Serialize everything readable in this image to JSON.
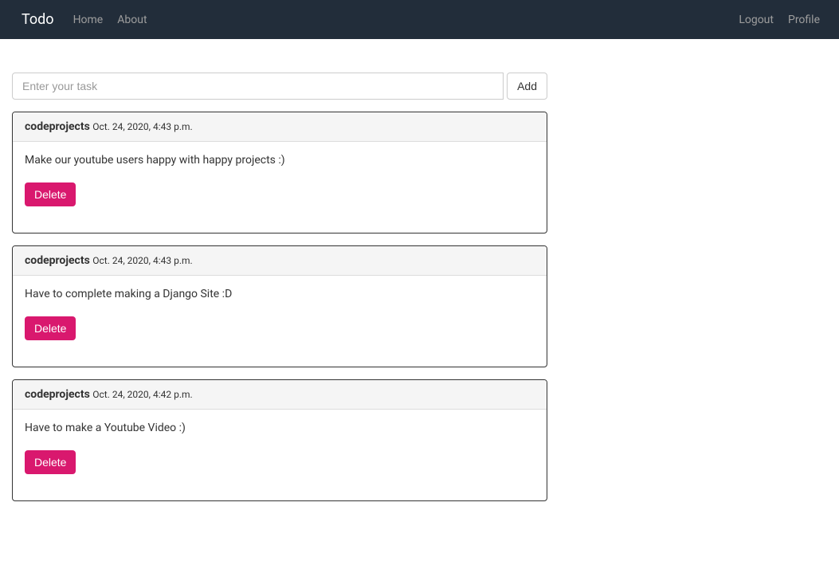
{
  "navbar": {
    "brand": "Todo",
    "left_links": [
      {
        "label": "Home"
      },
      {
        "label": "About"
      }
    ],
    "right_links": [
      {
        "label": "Logout"
      },
      {
        "label": "Profile"
      }
    ]
  },
  "task_input": {
    "placeholder": "Enter your task",
    "add_button": "Add"
  },
  "todos": [
    {
      "username": "codeprojects",
      "timestamp": "Oct. 24, 2020, 4:43 p.m.",
      "content": "Make our youtube users happy with happy projects :)",
      "delete_label": "Delete"
    },
    {
      "username": "codeprojects",
      "timestamp": "Oct. 24, 2020, 4:43 p.m.",
      "content": "Have to complete making a Django Site :D",
      "delete_label": "Delete"
    },
    {
      "username": "codeprojects",
      "timestamp": "Oct. 24, 2020, 4:42 p.m.",
      "content": "Have to make a Youtube Video :)",
      "delete_label": "Delete"
    }
  ]
}
